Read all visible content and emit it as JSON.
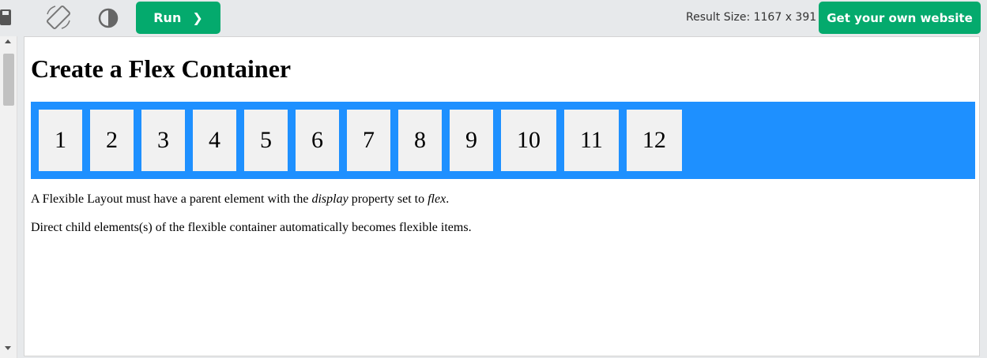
{
  "toolbar": {
    "run_label": "Run",
    "run_chevron": "❯",
    "result_size": "Result Size: 1167 x 391",
    "own_website_label": "Get your own website"
  },
  "icons": {
    "save": "save-icon",
    "rotate": "rotate-icon",
    "contrast": "contrast-icon"
  },
  "result": {
    "heading": "Create a Flex Container",
    "items": [
      "1",
      "2",
      "3",
      "4",
      "5",
      "6",
      "7",
      "8",
      "9",
      "10",
      "11",
      "12"
    ],
    "para1_before": "A Flexible Layout must have a parent element with the ",
    "para1_em1": "display",
    "para1_middle": " property set to ",
    "para1_em2": "flex",
    "para1_after": ".",
    "para2": "Direct child elements(s) of the flexible container automatically becomes flexible items."
  },
  "colors": {
    "accent_green": "#04aa6d",
    "flex_container_bg": "#1e90ff",
    "flex_item_bg": "#f1f1f1"
  }
}
